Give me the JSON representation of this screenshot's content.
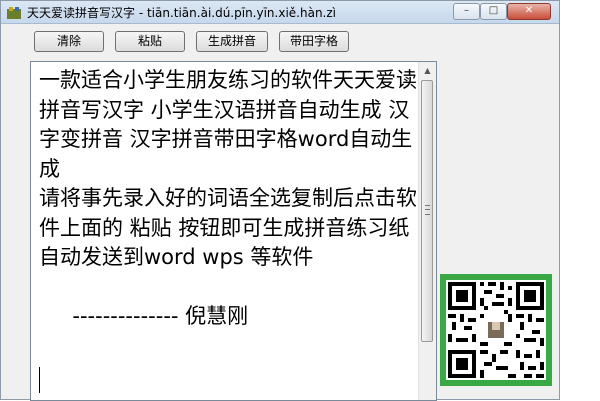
{
  "window": {
    "title": "天天爱读拼音写汉字 - tiān.tiān.ài.dú.pīn.yīn.xiě.hàn.zì",
    "app_icon": "app-icon",
    "controls": {
      "minimize": "–",
      "maximize": "□",
      "close": "✕"
    }
  },
  "toolbar": {
    "clear_label": "清除",
    "paste_label": "粘贴",
    "generate_label": "生成拼音",
    "grid_label": "带田字格"
  },
  "editor": {
    "content": "一款适合小学生朋友练习的软件天天爱读拼音写汉字 小学生汉语拼音自动生成 汉字变拼音 汉字拼音带田字格word自动生成\n请将事先录入好的词语全选复制后点击软件上面的 粘贴 按钮即可生成拼音练习纸自动发送到word wps 等软件\n\n     -------------- 倪慧刚"
  },
  "qr": {
    "icon": "qr-code-icon",
    "border_color": "#3aa845"
  }
}
